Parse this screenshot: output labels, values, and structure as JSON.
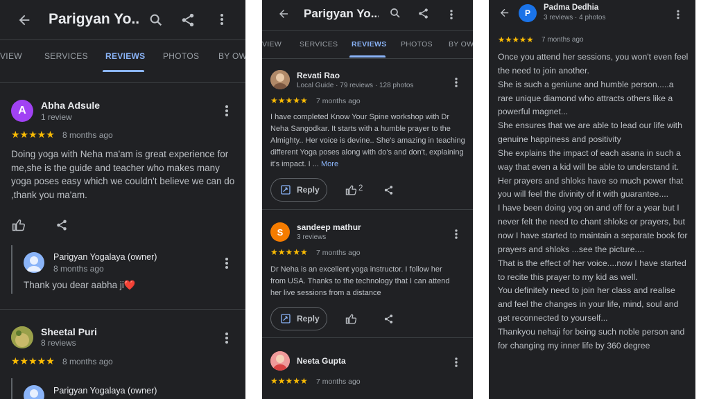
{
  "app": {
    "place_title": "Parigyan Yo...",
    "place_title_short": "Parigyan Yo..."
  },
  "tabs": [
    "VIEW",
    "SERVICES",
    "REVIEWS",
    "PHOTOS",
    "BY OWN"
  ],
  "tabs_p2": [
    "VIEW",
    "SERVICES",
    "REVIEWS",
    "PHOTOS",
    "BY OW"
  ],
  "panel1": {
    "reviews": [
      {
        "initial": "A",
        "avatar_color": "#a142f4",
        "name": "Abha Adsule",
        "meta": "1 review",
        "stars": "★★★★★",
        "time": "8 months ago",
        "text": "Doing yoga with Neha ma'am is great experience for me,she is the guide and teacher who makes many yoga poses easy which we couldn't believe we can do ,thank you ma'am.",
        "owner": {
          "name": "Parigyan Yogalaya (owner)",
          "time": "8 months ago",
          "text": "Thank you dear aabha ji❤️"
        }
      },
      {
        "name": "Sheetal Puri",
        "meta": "8 reviews",
        "stars": "★★★★★",
        "time": "8 months ago",
        "owner": {
          "name": "Parigyan Yogalaya (owner)"
        }
      }
    ]
  },
  "panel2": {
    "reviews": [
      {
        "name": "Revati Rao",
        "meta": "Local Guide · 79 reviews · 128 photos",
        "stars": "★★★★★",
        "time": "7 months ago",
        "text": "I have completed Know Your Spine workshop with Dr Neha Sangodkar. It starts with a humble prayer to the Almighty.. Her voice is devine.. She's amazing in teaching different Yoga poses along with do's and don't, explaining it's impact. I ...",
        "more": "More",
        "reply_label": "Reply",
        "likes": "2"
      },
      {
        "initial": "S",
        "avatar_color": "#f57c00",
        "name": "sandeep mathur",
        "meta": "3 reviews",
        "stars": "★★★★★",
        "time": "7 months ago",
        "text": "Dr Neha is an excellent yoga instructor. I follow her from USA. Thanks to the technology that I can attend her live sessions from a distance",
        "reply_label": "Reply"
      },
      {
        "name": "Neeta Gupta",
        "stars": "★★★★★",
        "time": "7 months ago"
      }
    ]
  },
  "panel3": {
    "initial": "P",
    "avatar_color": "#1a73e8",
    "name": "Padma Dedhia",
    "meta": "3 reviews · 4 photos",
    "stars": "★★★★★",
    "time": "7 months ago",
    "text": "Once you attend her sessions, you won't even feel the need to join another.\nShe is such a geniune and humble person.....a rare unique diamond who attracts others like a powerful magnet...\nShe ensures that we are able to lead our life with genuine happiness and positivity\nShe explains the impact of each asana in such a way that even a kid will be able to understand it.\nHer prayers and shloks have so much power that you will feel the divinity of it with guarantee....\nI have been doing yog on and off for a year but I never felt the need to chant shloks or prayers, but now I have started to maintain a separate book for prayers and shloks ...see the picture....\nThat is the effect of her voice....now I have started to recite this prayer to my kid as well.\nYou definitely need to join her class and realise and feel the changes in your life, mind, soul and get reconnected to yourself...\nThankyou nehaji for being such noble person and for changing my inner life by 360 degree"
  },
  "colors": {
    "accent": "#8ab4f8",
    "star": "#fbbc04",
    "background": "#202124",
    "heart": "#ea4335"
  },
  "icons": [
    "back-arrow-icon",
    "search-icon",
    "share-icon",
    "more-vert-icon",
    "thumbs-up-icon",
    "reply-icon"
  ]
}
